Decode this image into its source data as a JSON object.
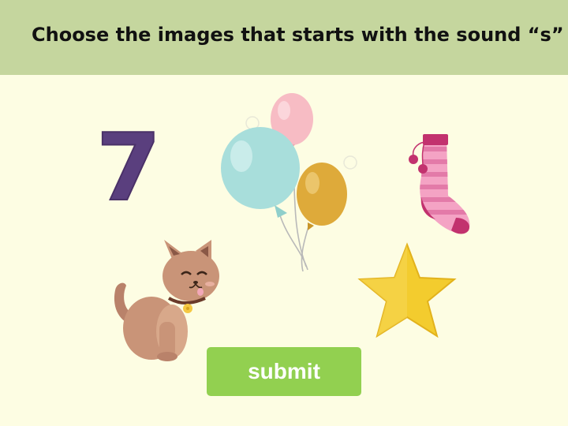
{
  "header": {
    "title": "Choose the images that starts with the sound “s”"
  },
  "choices": [
    {
      "id": "seven",
      "icon": "number-seven-icon"
    },
    {
      "id": "balloons",
      "icon": "balloons-icon"
    },
    {
      "id": "sock",
      "icon": "sock-icon"
    },
    {
      "id": "cat",
      "icon": "cat-icon"
    },
    {
      "id": "star",
      "icon": "star-icon"
    }
  ],
  "seven_label": "7",
  "submit_label": "submit",
  "colors": {
    "header_bg": "#c5d69e",
    "page_bg": "#fdfde3",
    "submit_bg": "#92d050"
  }
}
